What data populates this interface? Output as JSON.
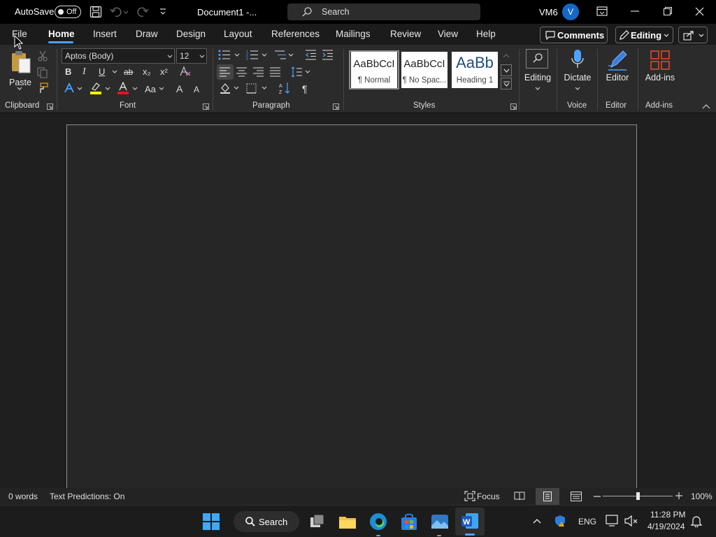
{
  "titlebar": {
    "autosave_label": "AutoSave",
    "autosave_state": "Off",
    "doc_title": "Document1  -...",
    "search_placeholder": "Search",
    "user_initials": "VM6",
    "avatar_letter": "V"
  },
  "tabs": [
    "File",
    "Home",
    "Insert",
    "Draw",
    "Design",
    "Layout",
    "References",
    "Mailings",
    "Review",
    "View",
    "Help"
  ],
  "active_tab": "Home",
  "actions": {
    "comments": "Comments",
    "editing": "Editing"
  },
  "ribbon": {
    "clipboard": {
      "paste": "Paste",
      "group": "Clipboard"
    },
    "font": {
      "family": "Aptos (Body)",
      "size": "12",
      "group": "Font",
      "bold": "B",
      "italic": "I",
      "underline": "U",
      "strike": "ab",
      "subscript": "x₂",
      "superscript": "x²",
      "change_case": "Aa",
      "grow": "A",
      "shrink": "A"
    },
    "paragraph": {
      "group": "Paragraph",
      "pilcrow": "¶"
    },
    "styles": {
      "group": "Styles",
      "items": [
        {
          "sample": "AaBbCcI",
          "name": "¶ Normal"
        },
        {
          "sample": "AaBbCcI",
          "name": "¶ No Spac..."
        },
        {
          "sample": "AaBb",
          "name": "Heading 1"
        }
      ]
    },
    "editing": {
      "label": "Editing"
    },
    "voice": {
      "label": "Dictate",
      "group": "Voice"
    },
    "editor": {
      "label": "Editor",
      "group": "Editor"
    },
    "addins": {
      "label": "Add-ins",
      "group": "Add-ins"
    }
  },
  "statusbar": {
    "words": "0 words",
    "predictions": "Text Predictions: On",
    "focus": "Focus",
    "zoom": "100%"
  },
  "taskbar": {
    "search": "Search",
    "lang": "ENG",
    "time": "11:28 PM",
    "date": "4/19/2024"
  },
  "colors": {
    "accent": "#4da3ff",
    "highlight_yellow": "#ffff00",
    "font_red": "#e81123",
    "word_blue": "#185abd"
  }
}
